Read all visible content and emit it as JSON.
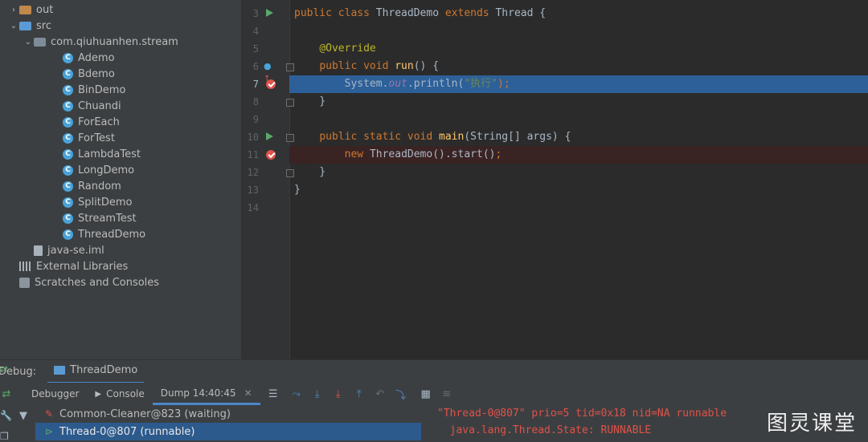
{
  "project_tree": [
    {
      "label": "out",
      "icon": "folder-orange-icon",
      "indent": 0,
      "arrow": "›"
    },
    {
      "label": "src",
      "icon": "folder-blue-icon",
      "indent": 0,
      "arrow": "⌄"
    },
    {
      "label": "com.qiuhuanhen.stream",
      "icon": "package-icon",
      "indent": 1,
      "arrow": "⌄"
    },
    {
      "label": "Ademo",
      "icon": "class-icon",
      "indent": 3,
      "arrow": ""
    },
    {
      "label": "Bdemo",
      "icon": "class-icon",
      "indent": 3,
      "arrow": ""
    },
    {
      "label": "BinDemo",
      "icon": "class-icon",
      "indent": 3,
      "arrow": ""
    },
    {
      "label": "Chuandi",
      "icon": "class-icon",
      "indent": 3,
      "arrow": ""
    },
    {
      "label": "ForEach",
      "icon": "class-icon",
      "indent": 3,
      "arrow": ""
    },
    {
      "label": "ForTest",
      "icon": "class-icon",
      "indent": 3,
      "arrow": ""
    },
    {
      "label": "LambdaTest",
      "icon": "class-icon",
      "indent": 3,
      "arrow": ""
    },
    {
      "label": "LongDemo",
      "icon": "class-icon",
      "indent": 3,
      "arrow": ""
    },
    {
      "label": "Random",
      "icon": "class-icon",
      "indent": 3,
      "arrow": ""
    },
    {
      "label": "SplitDemo",
      "icon": "class-icon",
      "indent": 3,
      "arrow": ""
    },
    {
      "label": "StreamTest",
      "icon": "class-icon",
      "indent": 3,
      "arrow": ""
    },
    {
      "label": "ThreadDemo",
      "icon": "class-icon",
      "indent": 3,
      "arrow": ""
    },
    {
      "label": "java-se.iml",
      "icon": "file-icon",
      "indent": 1,
      "arrow": ""
    },
    {
      "label": "External Libraries",
      "icon": "library-icon",
      "indent": 0,
      "arrow": ""
    },
    {
      "label": "Scratches and Consoles",
      "icon": "scratches-icon",
      "indent": 0,
      "arrow": ""
    }
  ],
  "editor": {
    "lines": [
      {
        "n": "3",
        "gutter": "run",
        "fold": false,
        "hl": "",
        "tokens": [
          [
            "kw",
            "public class "
          ],
          [
            "",
            "ThreadDemo "
          ],
          [
            "kw",
            "extends "
          ],
          [
            "",
            "Thread {"
          ]
        ]
      },
      {
        "n": "4",
        "gutter": "",
        "fold": false,
        "hl": "",
        "tokens": []
      },
      {
        "n": "5",
        "gutter": "",
        "fold": false,
        "hl": "",
        "tokens": [
          [
            "",
            "    "
          ],
          [
            "ann",
            "@Override"
          ]
        ]
      },
      {
        "n": "6",
        "gutter": "override",
        "fold": true,
        "hl": "",
        "tokens": [
          [
            "",
            "    "
          ],
          [
            "kw",
            "public void "
          ],
          [
            "fn",
            "run"
          ],
          [
            "",
            "() {"
          ]
        ]
      },
      {
        "n": "7",
        "gutter": "breakpoint",
        "fold": false,
        "hl": "blue",
        "tokens": [
          [
            "",
            "        System."
          ],
          [
            "it",
            "out"
          ],
          [
            "",
            ".println("
          ],
          [
            "str",
            "\"执行\""
          ],
          [
            "kw",
            ");"
          ]
        ]
      },
      {
        "n": "8",
        "gutter": "",
        "fold": true,
        "hl": "",
        "tokens": [
          [
            "",
            "    }"
          ]
        ]
      },
      {
        "n": "9",
        "gutter": "",
        "fold": false,
        "hl": "",
        "tokens": []
      },
      {
        "n": "10",
        "gutter": "run",
        "fold": true,
        "hl": "",
        "tokens": [
          [
            "",
            "    "
          ],
          [
            "kw",
            "public static void "
          ],
          [
            "fn",
            "main"
          ],
          [
            "",
            "(String[] args) {"
          ]
        ]
      },
      {
        "n": "11",
        "gutter": "breakpoint",
        "fold": false,
        "hl": "red",
        "tokens": [
          [
            "",
            "        "
          ],
          [
            "kw",
            "new "
          ],
          [
            "",
            "ThreadDemo().start()"
          ],
          [
            "kw",
            ";"
          ]
        ]
      },
      {
        "n": "12",
        "gutter": "",
        "fold": true,
        "hl": "",
        "tokens": [
          [
            "",
            "    }"
          ]
        ]
      },
      {
        "n": "13",
        "gutter": "",
        "fold": false,
        "hl": "",
        "tokens": [
          [
            "",
            "}"
          ]
        ]
      },
      {
        "n": "14",
        "gutter": "",
        "fold": false,
        "hl": "",
        "tokens": []
      }
    ]
  },
  "debug": {
    "label": "Debug:",
    "run_config": "ThreadDemo",
    "tabs": [
      {
        "label": "Debugger",
        "active": false
      },
      {
        "label": "Console",
        "active": false
      },
      {
        "label": "Dump 14:40:45",
        "active": true
      }
    ],
    "threads": [
      {
        "label": "Common-Cleaner@823 (waiting)",
        "icon": "thread-waiting-icon",
        "selected": false
      },
      {
        "label": "Thread-0@807 (runnable)",
        "icon": "thread-running-icon",
        "selected": true
      }
    ],
    "dump_lines": [
      "\"Thread-0@807\" prio=5 tid=0x18 nid=NA runnable",
      "  java.lang.Thread.State: RUNNABLE"
    ]
  },
  "watermark": "图灵课堂"
}
